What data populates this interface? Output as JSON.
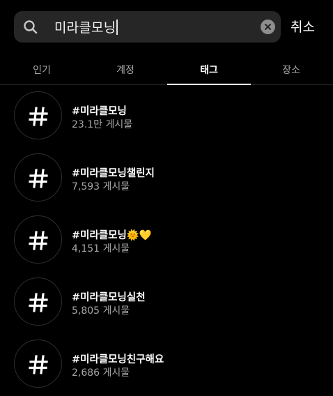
{
  "search": {
    "query": "미라클모닝",
    "cancel_label": "취소"
  },
  "tabs": [
    {
      "label": "인기",
      "active": false
    },
    {
      "label": "계정",
      "active": false
    },
    {
      "label": "태그",
      "active": true
    },
    {
      "label": "장소",
      "active": false
    }
  ],
  "results": [
    {
      "name": "#미라클모닝",
      "count": "23.1만 게시물"
    },
    {
      "name": "#미라클모닝챌린지",
      "count": "7,593 게시물"
    },
    {
      "name": "#미라클모닝🌞💛",
      "count": "4,151 게시물"
    },
    {
      "name": "#미라클모닝실천",
      "count": "5,805 게시물"
    },
    {
      "name": "#미라클모닝친구해요",
      "count": "2,686 게시물"
    }
  ],
  "icons": {
    "search": "search-icon",
    "clear": "clear-icon",
    "hashtag": "hashtag-icon"
  }
}
